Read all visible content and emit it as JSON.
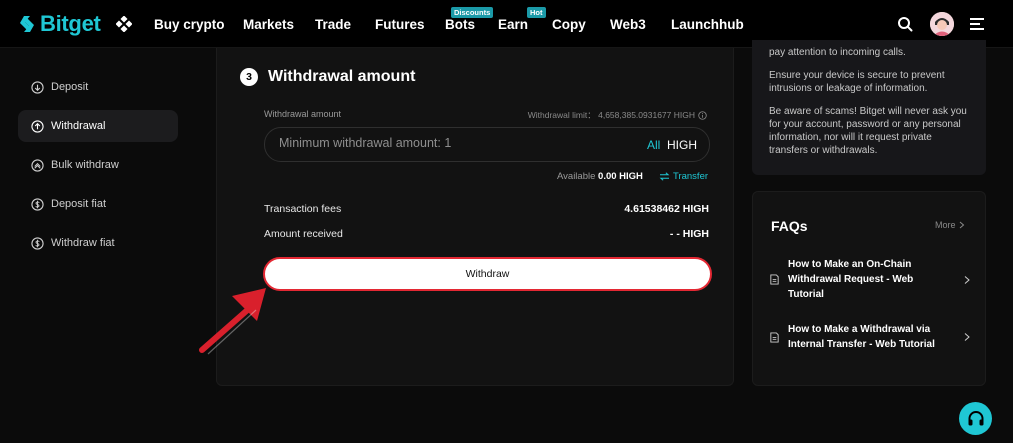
{
  "brand": {
    "name": "Bitget",
    "accent": "#1fc7d4"
  },
  "nav": {
    "items": [
      {
        "label": "Buy crypto"
      },
      {
        "label": "Markets"
      },
      {
        "label": "Trade"
      },
      {
        "label": "Futures"
      },
      {
        "label": "Bots",
        "badge": "Discounts"
      },
      {
        "label": "Earn",
        "badge": "Hot"
      },
      {
        "label": "Copy"
      },
      {
        "label": "Web3"
      },
      {
        "label": "Launchhub"
      }
    ],
    "icons": [
      "apps-icon",
      "search-icon",
      "avatar",
      "menu-icon"
    ]
  },
  "sidebar": {
    "items": [
      {
        "label": "Deposit",
        "icon": "deposit-icon"
      },
      {
        "label": "Withdrawal",
        "icon": "withdrawal-icon",
        "active": true
      },
      {
        "label": "Bulk withdraw",
        "icon": "bulk-withdraw-icon"
      },
      {
        "label": "Deposit fiat",
        "icon": "deposit-fiat-icon"
      },
      {
        "label": "Withdraw fiat",
        "icon": "withdraw-fiat-icon"
      }
    ]
  },
  "withdraw": {
    "step_number": "3",
    "step_title": "Withdrawal amount",
    "amount_label": "Withdrawal amount",
    "limit_text": "Withdrawal limit： 4,658,385.0931677 HIGH",
    "amount_placeholder": "Minimum withdrawal amount: 1",
    "amount_value": "",
    "all_label": "All",
    "unit": "HIGH",
    "available_label": "Available",
    "available_value": "0.00 HIGH",
    "transfer_label": "Transfer",
    "fees_label": "Transaction fees",
    "fees_value": "4.61538462 HIGH",
    "received_label": "Amount received",
    "received_value": "- - HIGH",
    "withdraw_button": "Withdraw",
    "highlight_color": "#e32833"
  },
  "tips": [
    "pay attention to incoming calls.",
    "Ensure your device is secure to prevent intrusions or leakage of information.",
    "Be aware of scams! Bitget will never ask you for your account, password or any personal information, nor will it request private transfers or withdrawals."
  ],
  "faq": {
    "title": "FAQs",
    "more_label": "More",
    "items": [
      "How to Make an On-Chain Withdrawal Request - Web Tutorial",
      "How to Make a Withdrawal via Internal Transfer - Web Tutorial"
    ]
  }
}
